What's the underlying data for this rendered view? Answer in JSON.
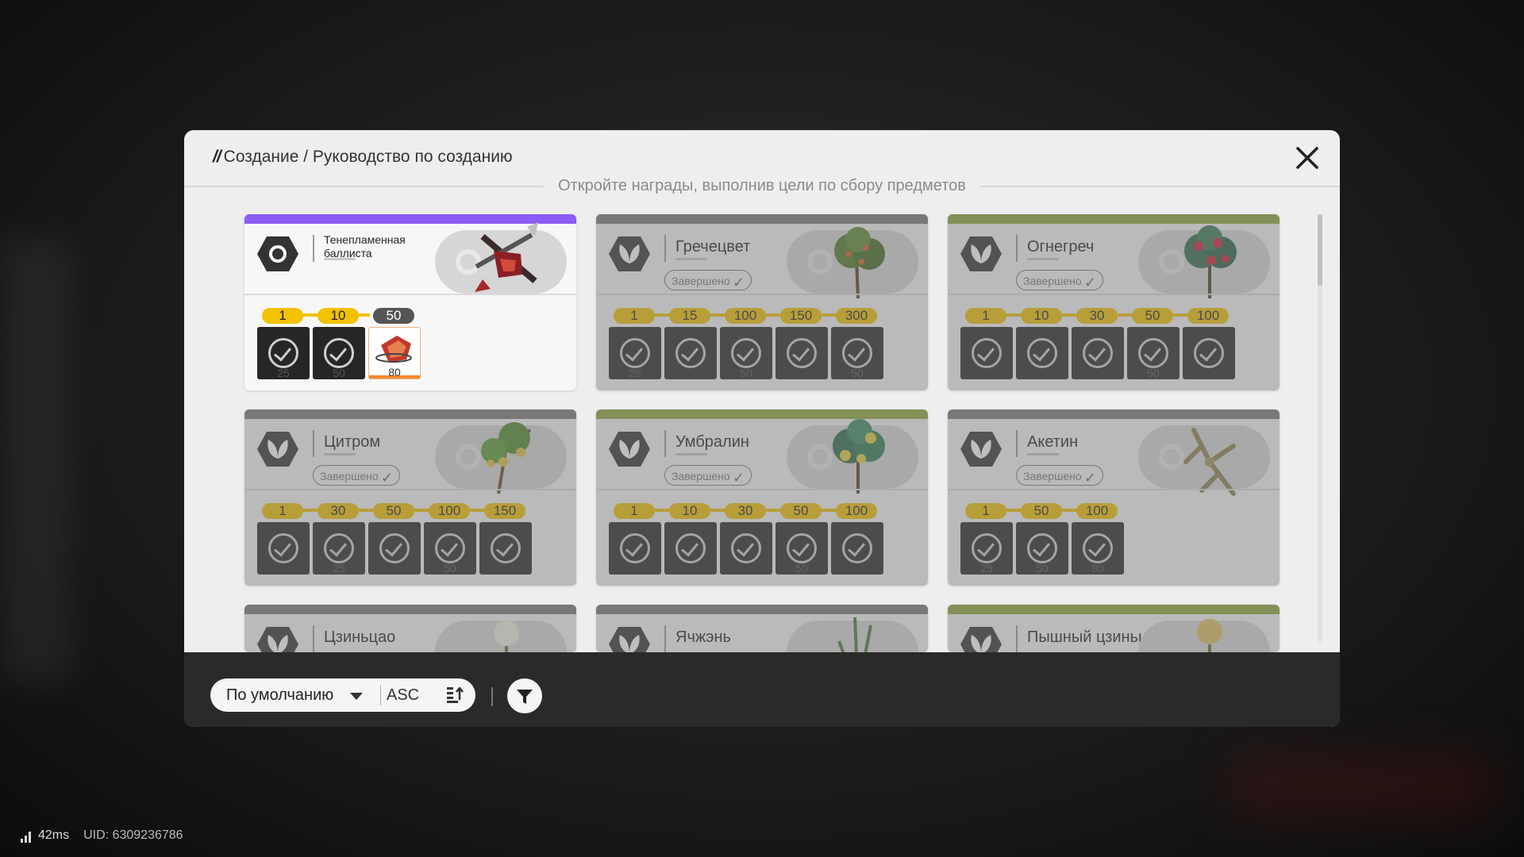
{
  "header": {
    "breadcrumb_prefix": "//",
    "breadcrumb": "Создание / Руководство по созданию",
    "subtitle": "Откройте награды, выполнив цели по сбору предметов"
  },
  "status_done_label": "Завершено",
  "cards": [
    {
      "name": "Тенепламенная баллиста",
      "bar_color": "#8b5cf6",
      "milestones": [
        "1",
        "10",
        "50"
      ],
      "slot_numbers": [
        "25",
        "50",
        "80"
      ]
    },
    {
      "name": "Гречецвет",
      "bar_color": "#7a7a7a",
      "milestones": [
        "1",
        "15",
        "100",
        "150",
        "300"
      ],
      "slot_numbers": [
        "25",
        "",
        "50",
        "",
        "50"
      ]
    },
    {
      "name": "Огнегреч",
      "bar_color": "#8fa73a",
      "milestones": [
        "1",
        "10",
        "30",
        "50",
        "100"
      ],
      "slot_numbers": [
        "",
        "",
        "",
        "50",
        ""
      ]
    },
    {
      "name": "Цитром",
      "bar_color": "#7a7a7a",
      "milestones": [
        "1",
        "30",
        "50",
        "100",
        "150"
      ],
      "slot_numbers": [
        "",
        "25",
        "",
        "50",
        ""
      ]
    },
    {
      "name": "Умбралин",
      "bar_color": "#8fa73a",
      "milestones": [
        "1",
        "10",
        "30",
        "50",
        "100"
      ],
      "slot_numbers": [
        "",
        "",
        "",
        "50",
        ""
      ]
    },
    {
      "name": "Акетин",
      "bar_color": "#7a7a7a",
      "milestones": [
        "1",
        "50",
        "100"
      ],
      "slot_numbers": [
        "25",
        "50",
        "80"
      ]
    },
    {
      "name": "Цзиньцао",
      "bar_color": "#7a7a7a"
    },
    {
      "name": "Ячжэнь",
      "bar_color": "#7a7a7a"
    },
    {
      "name": "Пышный цзиньцао",
      "bar_color": "#8fa73a"
    }
  ],
  "footer": {
    "sort_label": "По умолчанию",
    "order_label": "ASC"
  },
  "statusbar": {
    "ping": "42ms",
    "uid": "UID: 6309236786"
  },
  "icons": [
    "close-icon",
    "hexagon-icon",
    "leaf-icon",
    "check-circle-icon",
    "caret-down-icon",
    "sort-icon",
    "filter-icon",
    "signal-icon"
  ]
}
